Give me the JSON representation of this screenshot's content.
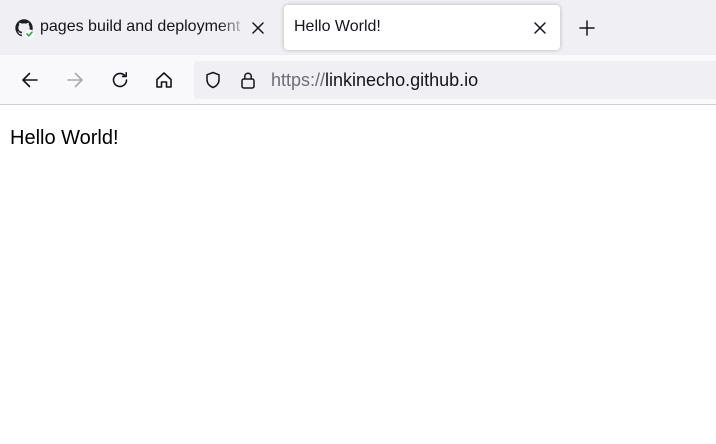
{
  "tabs": [
    {
      "title": "pages build and deployment",
      "icon": "github-icon",
      "active": false
    },
    {
      "title": "Hello World!",
      "active": true
    }
  ],
  "navigation": {
    "back_icon": "back-arrow-icon",
    "forward_icon": "forward-arrow-icon",
    "reload_icon": "reload-icon",
    "home_icon": "home-icon"
  },
  "urlbar": {
    "scheme": "https://",
    "host": "linkinecho.github.io"
  },
  "page": {
    "heading": "Hello World!"
  },
  "colors": {
    "tabstrip": "#f0f0f4",
    "toolbar": "#f9f9fb",
    "check_green": "#2ea44f"
  }
}
